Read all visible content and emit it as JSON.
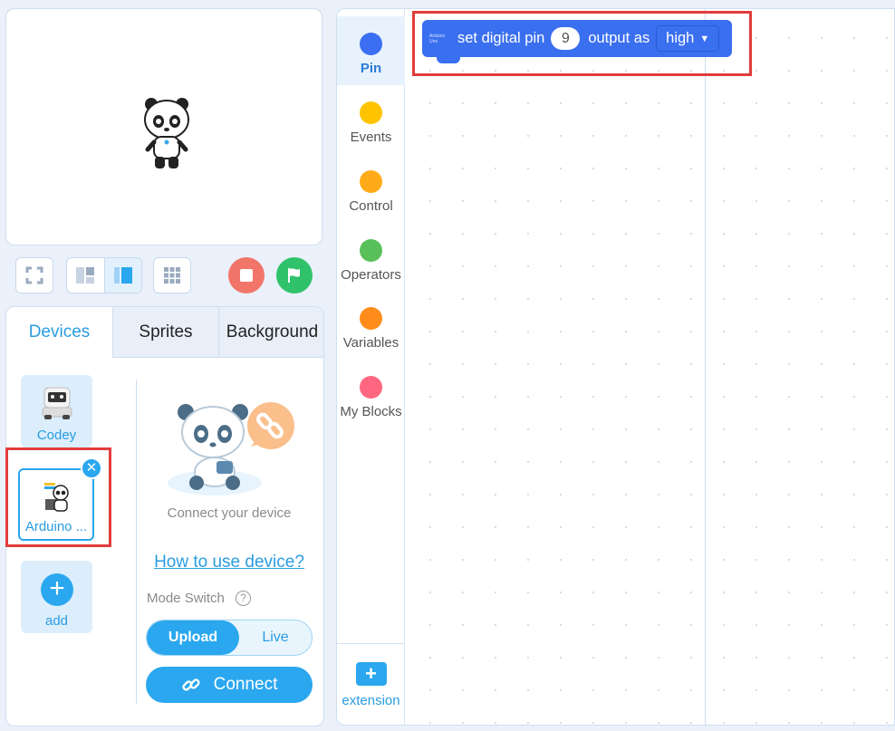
{
  "stage_tools": {
    "fullscreen_icon": "fullscreen-icon",
    "layout_small_icon": "layout-small-stage-icon",
    "layout_large_icon": "layout-large-stage-icon",
    "grid_icon": "grid-icon",
    "stop_icon": "stop-icon",
    "go_icon": "green-flag-icon"
  },
  "tabs": [
    "Devices",
    "Sprites",
    "Background"
  ],
  "devices": {
    "items": [
      {
        "label": "Codey"
      },
      {
        "label": "Arduino ..."
      }
    ],
    "add_label": "add",
    "connect_text": "Connect your device",
    "howto_link": "How to use device?",
    "mode_switch_label": "Mode Switch",
    "mode_help": "?",
    "mode_upload": "Upload",
    "mode_live": "Live",
    "connect_button": "Connect"
  },
  "categories": [
    {
      "label": "Pin",
      "color": "#3b6ef2"
    },
    {
      "label": "Events",
      "color": "#ffc400"
    },
    {
      "label": "Control",
      "color": "#ffab19"
    },
    {
      "label": "Operators",
      "color": "#59c059"
    },
    {
      "label": "Variables",
      "color": "#ff8c1a"
    },
    {
      "label": "My Blocks",
      "color": "#ff6680"
    }
  ],
  "extension_label": "extension",
  "block": {
    "tag": "Arduino Uno",
    "label1": "set digital pin",
    "pin": "9",
    "label2": "output as",
    "state": "high",
    "color": "#3a6ff0"
  },
  "colors": {
    "accent": "#2aa7ee",
    "highlight": "#e23c3c",
    "stop": "#f2756a",
    "go": "#2fc26b"
  }
}
